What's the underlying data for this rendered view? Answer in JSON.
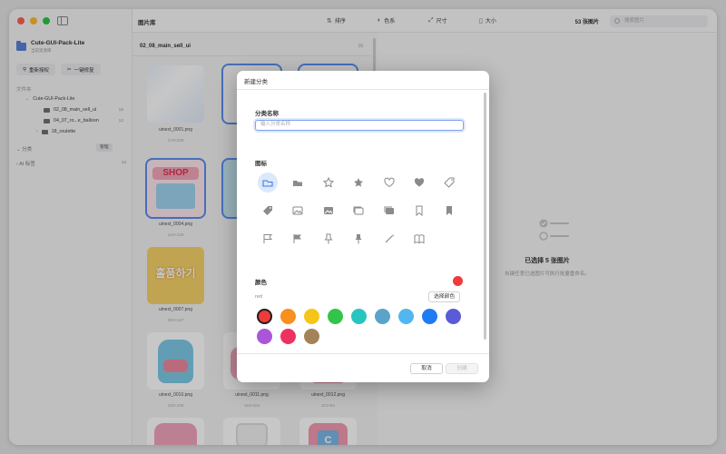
{
  "window": {
    "title": "图片库"
  },
  "sidebar": {
    "library_name": "Cute-GUI-Pack-Lite",
    "library_sub": "当前资源库",
    "rescan_label": "重新授权",
    "repair_label": "一键修复",
    "folders_header": "文件夹",
    "root_folder": "Cute-GUI-Pack-Lite",
    "folders": [
      {
        "name": "02_08_main_sell_ui",
        "count": "16"
      },
      {
        "name": "04_07_ro...e_balloon",
        "count": "12"
      },
      {
        "name": "18_roulette",
        "count": ""
      }
    ],
    "categories_header": "分类",
    "manage_label": "管理",
    "ai_tags_header": "AI 标签",
    "ai_tags_count": "18"
  },
  "toolbar": {
    "sort_label": "排序",
    "color_label": "色系",
    "size_label": "尺寸",
    "filesize_label": "大小",
    "image_count": "53 张图片",
    "search_placeholder": "搜索图片"
  },
  "grid": {
    "folder_name": "02_08_main_sell_ui",
    "folder_count": "16",
    "items": [
      {
        "name": "uinext_0001.png",
        "dim": "174×239"
      },
      {
        "name": "uinext_0004.png",
        "dim": "134×128"
      },
      {
        "name": "uinext_0007.png",
        "dim": "292×187"
      },
      {
        "name": "uinext_0010.png",
        "dim": "120×109"
      },
      {
        "name": "uinext_0011.png",
        "dim": "112×104"
      },
      {
        "name": "uinext_0012.png",
        "dim": "101×94"
      }
    ],
    "shop_text": "SHOP",
    "korean_text": "홀품하기",
    "shirt_letter": "C"
  },
  "detail": {
    "title": "已选择 5 张图片",
    "subtitle": "右键任意已选图片可执行批量重命名。"
  },
  "dialog": {
    "title": "新建分类",
    "name_label": "分类名称",
    "name_placeholder": "输入分类名称",
    "icon_label": "图标",
    "icons": [
      "folder-icon",
      "folder-fill-icon",
      "star-icon",
      "star-fill-icon",
      "heart-icon",
      "heart-fill-icon",
      "tag-icon",
      "tag-fill-icon",
      "photo-icon",
      "photo-fill-icon",
      "photos-icon",
      "photos-fill-icon",
      "bookmark-icon",
      "bookmark-fill-icon",
      "flag-icon",
      "flag-fill-icon",
      "pin-icon",
      "pin-fill-icon",
      "wand-icon",
      "book-icon"
    ],
    "color_label": "颜色",
    "selected_color_name": "red",
    "pick_color_label": "选择颜色",
    "colors": [
      "#ef3b3a",
      "#f7901e",
      "#f6c519",
      "#33c54a",
      "#28c4c0",
      "#5aa4c9",
      "#53b6ef",
      "#1f7cf3",
      "#5b5bd6",
      "#ab55d8",
      "#ee3260",
      "#a38357"
    ],
    "cancel_label": "取消",
    "create_label": "创建"
  }
}
